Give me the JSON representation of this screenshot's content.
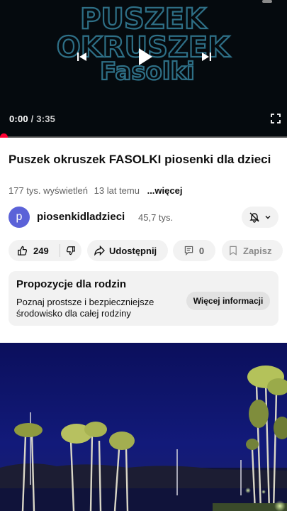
{
  "player": {
    "logo_line1": "PUSZEK",
    "logo_line2": "OKRUSZEK",
    "logo_line3": "Fasolki",
    "time_current": "0:00",
    "time_separator": " / ",
    "time_total": "3:35",
    "progress_fraction": 0.0,
    "accent_color": "#ff0033"
  },
  "video": {
    "title": "Puszek okruszek FASOLKI piosenki dla dzieci",
    "views": "177 tys. wyświetleń",
    "age": "13 lat temu",
    "more_label": "...więcej"
  },
  "channel": {
    "avatar_letter": "p",
    "name": "piosenkidladzieci",
    "subscribers": "45,7 tys.",
    "avatar_color": "#5b62d8"
  },
  "actions": {
    "like_count": "249",
    "share_label": "Udostępnij",
    "comment_count": "0",
    "save_label": "Zapisz"
  },
  "family_card": {
    "title": "Propozycje dla rodzin",
    "description": "Poznaj prostsze i bezpieczniejsze środowisko dla całej rodziny",
    "button_label": "Więcej informacji"
  },
  "icons": {
    "prev": "skip-previous-icon",
    "play": "play-icon",
    "next": "skip-next-icon",
    "fullscreen": "fullscreen-icon",
    "notify": "bell-off-icon",
    "like": "thumb-up-icon",
    "dislike": "thumb-down-icon",
    "share": "share-icon",
    "comment": "comment-icon",
    "save": "save-icon"
  }
}
